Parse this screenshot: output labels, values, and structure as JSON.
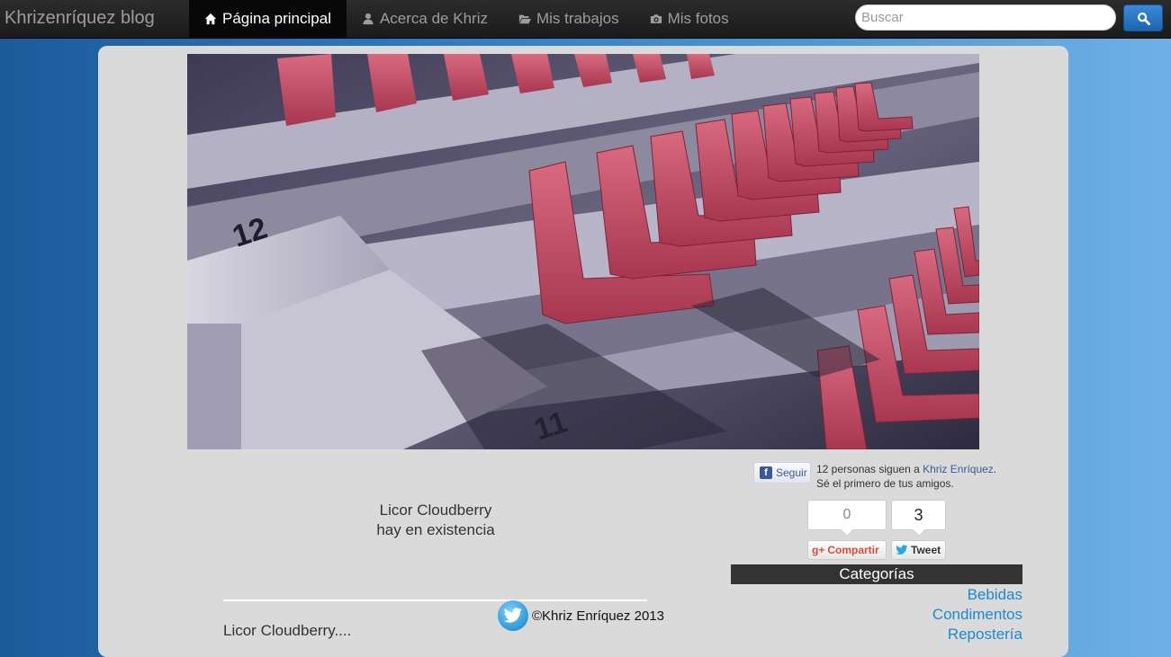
{
  "navbar": {
    "brand": "Khrizenríquez blog",
    "items": [
      {
        "label": "Página principal",
        "icon": "home-icon",
        "active": true
      },
      {
        "label": "Acerca de Khriz",
        "icon": "user-icon",
        "active": false
      },
      {
        "label": "Mis trabajos",
        "icon": "folder-open-icon",
        "active": false
      },
      {
        "label": "Mis fotos",
        "icon": "camera-icon",
        "active": false
      }
    ],
    "search": {
      "placeholder": "Buscar",
      "value": "",
      "button_icon": "search-icon"
    }
  },
  "hero": {
    "alt": "Stadium seats",
    "colors": {
      "seat": "#c24a60",
      "concrete": "#c8c4d4",
      "shadow": "#3a3650"
    }
  },
  "post": {
    "text_line1": "Licor Cloudberry",
    "text_line2": "hay en existencia",
    "title": "Licor Cloudberry...."
  },
  "facebook": {
    "follow_label": "Seguir",
    "followers_prefix": "12 personas siguen a ",
    "followers_link": "Khriz Enríquez",
    "followers_suffix": ".",
    "friends_text": "Sé el primero de tus amigos."
  },
  "share": {
    "gplus_count": "0",
    "tweet_count": "3",
    "gplus_label": "Compartir",
    "gplus_mark": "g+",
    "tweet_label": "Tweet"
  },
  "categories": {
    "title": "Categorías",
    "items": [
      "Bebidas",
      "Condimentos",
      "Repostería"
    ]
  },
  "footer": {
    "copyright": "©Khriz Enríquez 2013",
    "icon": "twitter-icon"
  }
}
